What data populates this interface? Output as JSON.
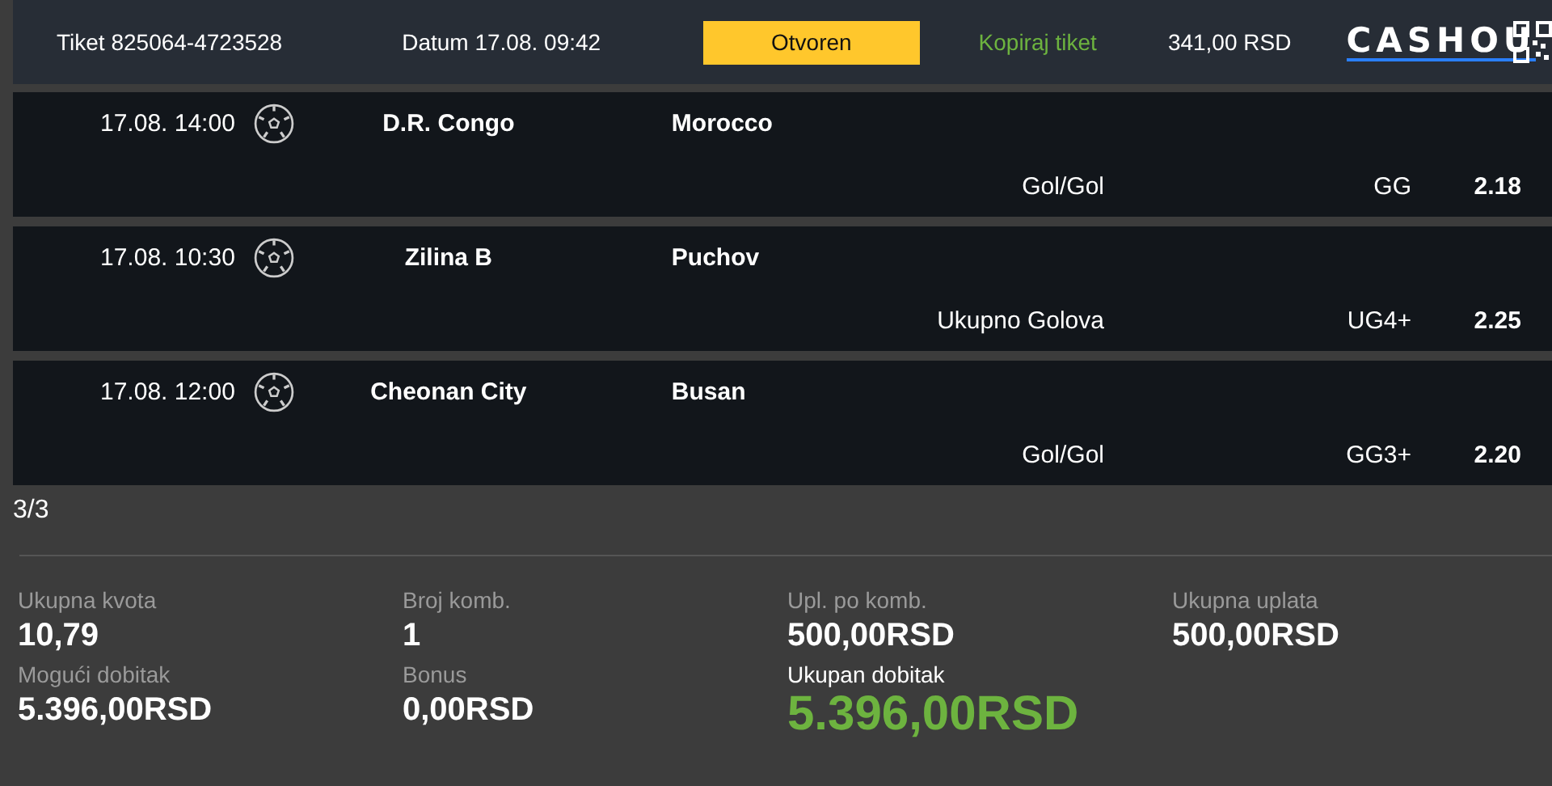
{
  "ticket": {
    "id": "Tiket 825064-4723528",
    "date": "Datum 17.08. 09:42",
    "status": "Otvoren",
    "copy_link": "Kopiraj tiket",
    "amount": "341,00 RSD",
    "logo": "CASHOU"
  },
  "matches": [
    {
      "time": "17.08. 14:00",
      "home": "D.R. Congo",
      "away": "Morocco",
      "market": "Gol/Gol",
      "pick": "GG",
      "odd": "2.18"
    },
    {
      "time": "17.08. 10:30",
      "home": "Zilina B",
      "away": "Puchov",
      "market": "Ukupno Golova",
      "pick": "UG4+",
      "odd": "2.25"
    },
    {
      "time": "17.08. 12:00",
      "home": "Cheonan City",
      "away": "Busan",
      "market": "Gol/Gol",
      "pick": "GG3+",
      "odd": "2.20"
    }
  ],
  "count": "3/3",
  "summary": [
    {
      "label": "Ukupna kvota",
      "value": "10,79",
      "kind": "plain"
    },
    {
      "label": "Broj komb.",
      "value": "1",
      "kind": "plain"
    },
    {
      "label": "Upl. po komb.",
      "value": "500,00RSD",
      "kind": "plain"
    },
    {
      "label": "Ukupna uplata",
      "value": "500,00RSD",
      "kind": "plain"
    },
    {
      "label": "Mogući dobitak",
      "value": "5.396,00RSD",
      "kind": "plain"
    },
    {
      "label": "Bonus",
      "value": "0,00RSD",
      "kind": "plain"
    },
    {
      "label": "Ukupan dobitak",
      "value": "5.396,00RSD",
      "kind": "total"
    }
  ]
}
